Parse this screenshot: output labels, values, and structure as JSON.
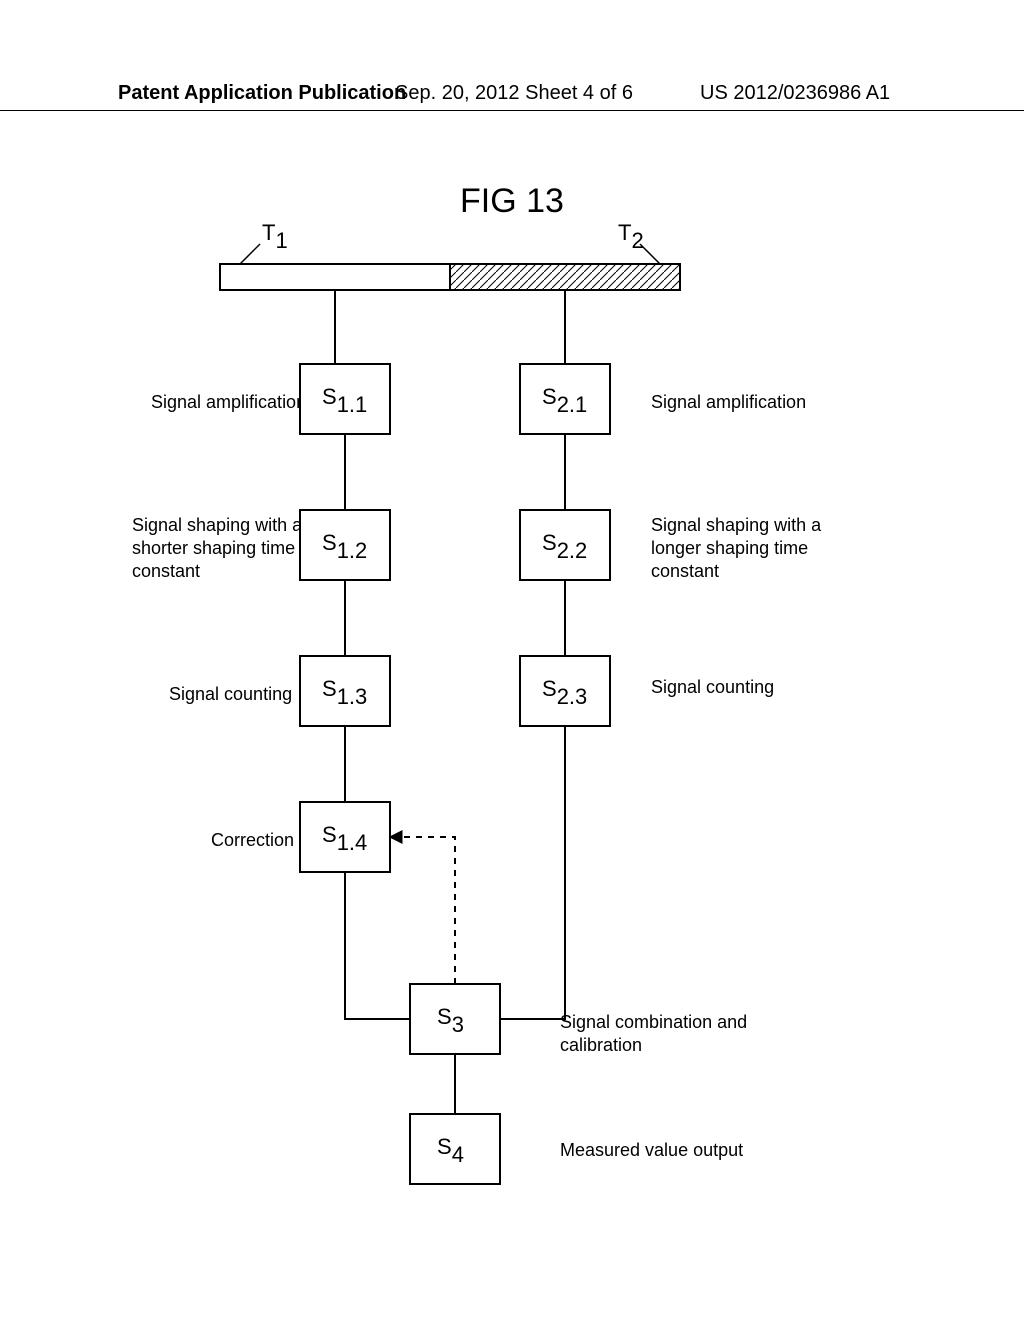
{
  "header": {
    "left": "Patent Application Publication",
    "center": "Sep. 20, 2012  Sheet 4 of 6",
    "right": "US 2012/0236986 A1"
  },
  "figure_title": "FIG 13",
  "top_labels": {
    "T1_main": "T",
    "T1_sub": "1",
    "T2_main": "T",
    "T2_sub": "2"
  },
  "box_labels": {
    "s11_main": "S",
    "s11_sub": "1.1",
    "s12_main": "S",
    "s12_sub": "1.2",
    "s13_main": "S",
    "s13_sub": "1.3",
    "s14_main": "S",
    "s14_sub": "1.4",
    "s21_main": "S",
    "s21_sub": "2.1",
    "s22_main": "S",
    "s22_sub": "2.2",
    "s23_main": "S",
    "s23_sub": "2.3",
    "s3_main": "S",
    "s3_sub": "3",
    "s4_main": "S",
    "s4_sub": "4"
  },
  "left_labels": {
    "l1": "Signal amplification",
    "l2a": "Signal shaping with a",
    "l2b": "shorter shaping time",
    "l2c": "constant",
    "l3": "Signal counting",
    "l4": "Correction"
  },
  "right_labels": {
    "r1": "Signal amplification",
    "r2a": "Signal shaping with a",
    "r2b": "longer shaping time",
    "r2c": "constant",
    "r3": "Signal counting",
    "r5a": "Signal combination and",
    "r5b": "calibration",
    "r6": "Measured value output"
  }
}
